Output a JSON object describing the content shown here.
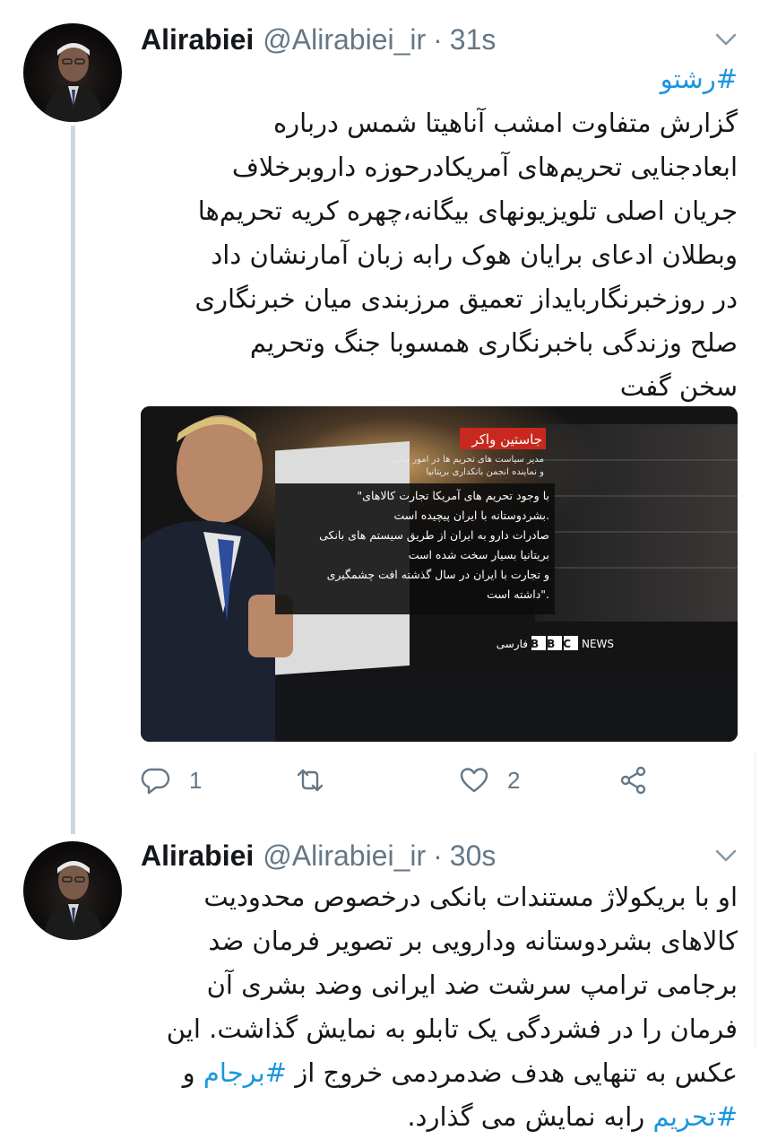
{
  "tweets": [
    {
      "name": "Alirabiei",
      "handle": "@Alirabiei_ir",
      "separator": "·",
      "time": "31s",
      "hashtag_line": "#رشتو",
      "lines": [
        "گزارش متفاوت امشب آناهیتا شمس درباره",
        "ابعادجنایی تحریم‌های آمریکادرحوزه داروبرخلاف",
        "جریان اصلی تلویزیونهای بیگانه،چهره کریه تحریم‌ها",
        "وبطلان ادعای برایان هوک رابه زبان آمارنشان داد",
        "در روزخبرنگاربایداز تعمیق مرزبندی میان خبرنگاری",
        "صلح وزندگی باخبرنگاری همسوبا جنگ وتحریم",
        "سخن گفت"
      ],
      "media": {
        "name_label": "جاستین واکر",
        "subtitle_1": "مدیر سیاست های تحریم ها در امور مالی",
        "subtitle_2": "و نماینده انجمن بانکداری بریتانیا",
        "quote_lines": [
          "\"با وجود تحریم های آمریکا تجارت کالاهای",
          "بشردوستانه با ایران پیچیده است.",
          "صادرات دارو به ایران از طریق سیستم های بانکی",
          "بریتانیا بسیار سخت شده است",
          "و تجارت با ایران در سال گذشته افت چشمگیری",
          "داشته است\"."
        ],
        "bbc_logo": "BBC",
        "bbc_news": "NEWS",
        "bbc_farsi": "فارسی"
      },
      "actions": {
        "reply_count": "1",
        "retweet_count": "",
        "like_count": "2"
      }
    },
    {
      "name": "Alirabiei",
      "handle": "@Alirabiei_ir",
      "separator": "·",
      "time": "30s",
      "lines": [
        "او با بریکولاژ مستندات بانکی درخصوص محدودیت",
        "کالاهای بشردوستانه ودارویی بر تصویر فرمان ضد",
        "برجامی ترامپ سرشت ضد ایرانی وضد بشری آن",
        "فرمان را در فشردگی یک تابلو به نمایش گذاشت. این"
      ],
      "line5_prefix": "عکس به تنهایی هدف ضدمردمی خروج از ",
      "line5_hashtag": "#برجام",
      "line5_suffix": " و",
      "line6_hashtag": "#تحریم",
      "line6_suffix": " رابه نمایش می گذارد."
    }
  ],
  "colors": {
    "link": "#1b95e0",
    "meta": "#657786",
    "text": "#14171a",
    "thread_line": "#ccd6dd",
    "bbc_red": "#c8281e"
  },
  "icons": [
    "chevron-down-icon",
    "reply-icon",
    "retweet-icon",
    "like-icon",
    "share-icon"
  ]
}
